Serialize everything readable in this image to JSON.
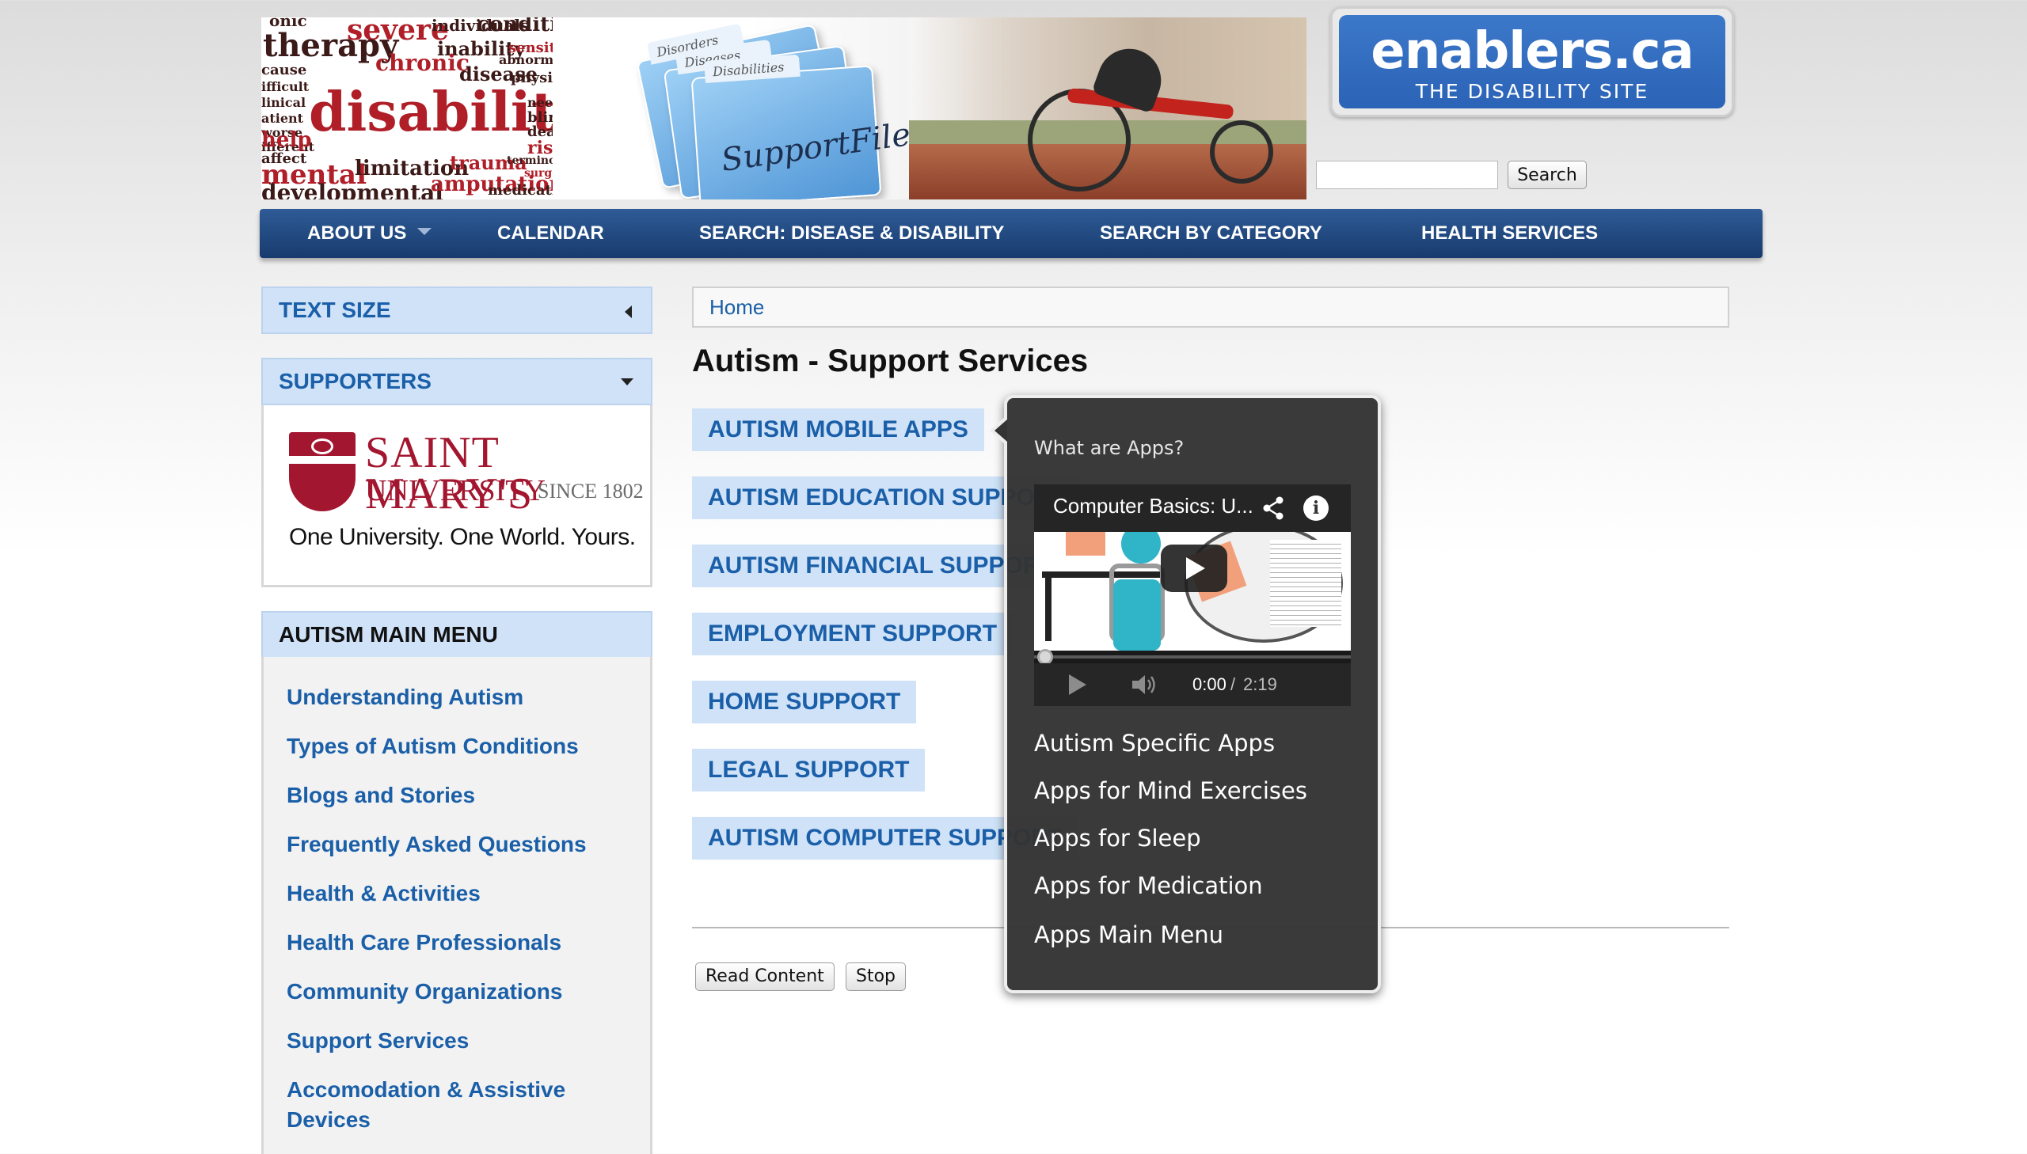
{
  "header": {
    "banner": {
      "words": {
        "w1": "onic",
        "w2": "severe",
        "w3": "individuals",
        "w4": "conditions",
        "w5": "therapy",
        "w6": "inability",
        "w7": "sensitivity",
        "w8": "cause",
        "w9": "chronic",
        "w10": "disease",
        "w11": "abnormality",
        "w12": "ifficult",
        "w13": "physical",
        "w14": "linical",
        "w15": "disability",
        "w16": "needs",
        "w17": "atient",
        "w18": "blind",
        "w19": "worse",
        "w20": "deaf",
        "w21": "ifferent",
        "w22": "risk",
        "w23": "help",
        "w24": "affect",
        "w25": "mental",
        "w26": "limitation",
        "w27": "trauma",
        "w28": "terminology",
        "w29": "surgery",
        "w30": "developmental",
        "w31": "amputation",
        "w32": "medication"
      },
      "folder_tabs": {
        "tab1": "Disorders",
        "tab2": "Diseases",
        "tab3": "Disabilities"
      },
      "folder_caption": "SupportFiles"
    },
    "logo": {
      "title": "enablers.ca",
      "subtitle": "THE DISABILITY SITE"
    },
    "search": {
      "value": "",
      "placeholder": "",
      "button_label": "Search"
    }
  },
  "nav": {
    "about": "ABOUT US",
    "calendar": "CALENDAR",
    "disease": "SEARCH: DISEASE & DISABILITY",
    "category": "SEARCH BY CATEGORY",
    "health": "HEALTH SERVICES"
  },
  "sidebar": {
    "text_size": "TEXT SIZE",
    "supporters": "SUPPORTERS",
    "supporter": {
      "name": "SAINT MARY'S",
      "university": "UNIVERSITY",
      "since": "SINCE 1802",
      "tagline": "One University. One World. Yours."
    },
    "menu_title": "AUTISM MAIN MENU",
    "menu": {
      "m0": "Understanding Autism",
      "m1": "Types of Autism Conditions",
      "m2": "Blogs and Stories",
      "m3": "Frequently Asked Questions",
      "m4": "Health & Activities",
      "m5": "Health Care Professionals",
      "m6": "Community Organizations",
      "m7": "Support Services",
      "m8": "Accomodation & Assistive Devices"
    }
  },
  "main": {
    "breadcrumb": "Home",
    "title": "Autism - Support Services",
    "categories": {
      "c0": "AUTISM MOBILE APPS",
      "c1": "AUTISM EDUCATION SUPPORT",
      "c2": "AUTISM FINANCIAL SUPPORT",
      "c3": "EMPLOYMENT SUPPORT",
      "c4": "HOME SUPPORT",
      "c5": "LEGAL SUPPORT",
      "c6": "AUTISM COMPUTER SUPPORT"
    },
    "read_content": "Read Content",
    "stop": "Stop"
  },
  "popup": {
    "heading": "What are Apps?",
    "video": {
      "title": "Computer Basics: U...",
      "info": "i",
      "time_current": "0:00",
      "time_separator": "/",
      "time_total": "2:19",
      "progress": 0
    },
    "links": {
      "l0": "Autism Specific Apps",
      "l1": "Apps for Mind Exercises",
      "l2": "Apps for Sleep",
      "l3": "Apps for Medication",
      "l4": "Apps Main Menu"
    }
  },
  "colors": {
    "accent": "#1a5fa8",
    "nav_bg": "#224a80",
    "button_bg": "#cfe2f8",
    "popup_bg": "#343434",
    "logo_bg": "#2b63b7",
    "smu_red": "#a3162f"
  }
}
